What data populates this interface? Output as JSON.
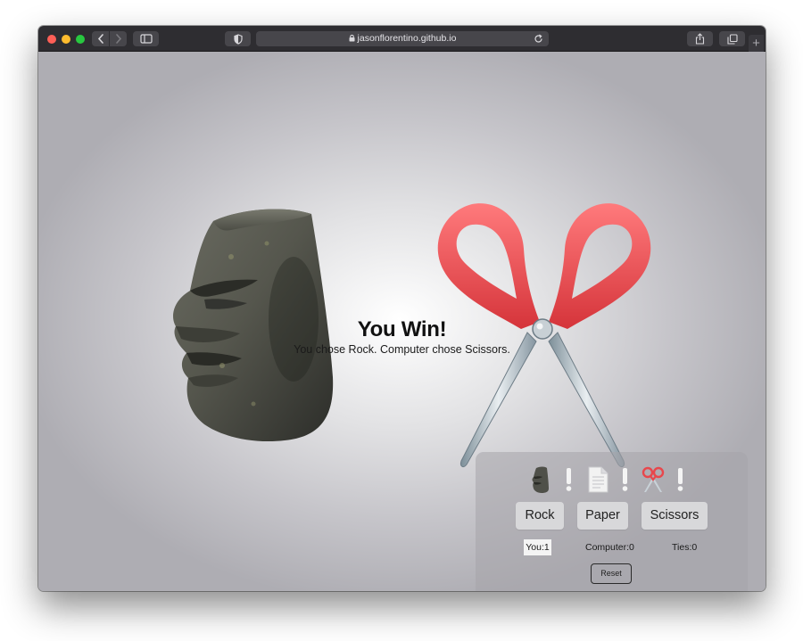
{
  "browser": {
    "url": "jasonflorentino.github.io"
  },
  "game": {
    "result_title": "You Win!",
    "result_message": "You chose Rock. Computer chose Scissors.",
    "player_choice_icon": "moai-icon",
    "computer_choice_icon": "scissors-icon"
  },
  "panel": {
    "options": {
      "rock": "Rock",
      "paper": "Paper",
      "scissors": "Scissors"
    },
    "scores": {
      "you": "You:1",
      "computer": "Computer:0",
      "ties": "Ties:0"
    },
    "reset_label": "Reset"
  },
  "colors": {
    "scissors_handle": "#e8474c",
    "toolbar": "#2e2d31"
  }
}
